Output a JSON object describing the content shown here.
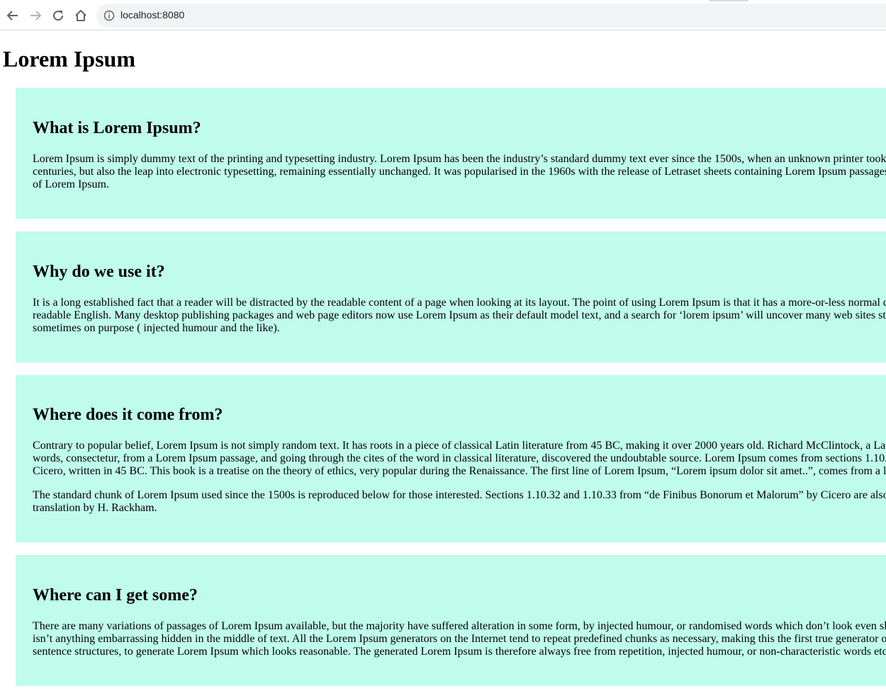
{
  "browser": {
    "url": "localhost:8080",
    "icons": [
      "back-icon",
      "forward-icon",
      "reload-icon",
      "home-icon",
      "info-icon"
    ]
  },
  "page": {
    "title": "Lorem Ipsum",
    "sections": [
      {
        "heading": "What is Lorem Ipsum?",
        "lines": [
          "Lorem Ipsum is simply dummy text of the printing and typesetting industry. Lorem Ipsum has been the industry’s standard dummy text ever since the 1500s, when an unknown printer took",
          "centuries, but also the leap into electronic typesetting, remaining essentially unchanged. It was popularised in the 1960s with the release of Letraset sheets containing Lorem Ipsum passages",
          "of Lorem Ipsum."
        ]
      },
      {
        "heading": "Why do we use it?",
        "lines": [
          "It is a long established fact that a reader will be distracted by the readable content of a page when looking at its layout. The point of using Lorem Ipsum is that it has a more-or-less normal d",
          "readable English. Many desktop publishing packages and web page editors now use Lorem Ipsum as their default model text, and a search for ‘lorem ipsum’ will uncover many web sites st",
          "sometimes on purpose ( injected humour and the like)."
        ]
      },
      {
        "heading": "Where does it come from?",
        "lines": [
          "Contrary to popular belief, Lorem Ipsum is not simply random text. It has roots in a piece of classical Latin literature from 45 BC, making it over 2000 years old. Richard McClintock, a La",
          "words, consectetur, from a Lorem Ipsum passage, and going through the cites of the word in classical literature, discovered the undoubtable source. Lorem Ipsum comes from sections 1.10.",
          "Cicero, written in 45 BC. This book is a treatise on the theory of ethics, very popular during the Renaissance. The first line of Lorem Ipsum, “Lorem ipsum dolor sit amet..”, comes from a l"
        ],
        "lines2": [
          "The standard chunk of Lorem Ipsum used since the 1500s is reproduced below for those interested. Sections 1.10.32 and 1.10.33 from “de Finibus Bonorum et Malorum” by Cicero are also",
          "translation by H. Rackham."
        ]
      },
      {
        "heading": "Where can I get some?",
        "lines": [
          "There are many variations of passages of Lorem Ipsum available, but the majority have suffered alteration in some form, by injected humour, or randomised words which don’t look even sl",
          "isn’t anything embarrassing hidden in the middle of text. All the Lorem Ipsum generators on the Internet tend to repeat predefined chunks as necessary, making this the first true generator o",
          "sentence structures, to generate Lorem Ipsum which looks reasonable. The generated Lorem Ipsum is therefore always free from repetition, injected humour, or non-characteristic words etc"
        ]
      }
    ]
  },
  "colors": {
    "card_background": "#c0fceb",
    "omnibox_background": "#f1f3f4"
  }
}
